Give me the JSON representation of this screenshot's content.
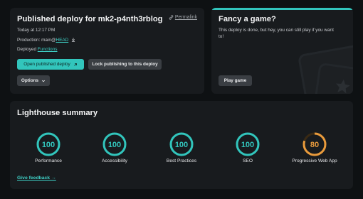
{
  "deploy": {
    "title": "Published deploy for mk2-p4nth3rblog",
    "permalink": "Permalink",
    "time": "Today at 12:17 PM",
    "production_prefix": "Production: main@",
    "production_ref": "HEAD",
    "deployed_prefix": "Deployed ",
    "deployed_link": "Functions",
    "open_button": "Open published deploy",
    "lock_button": "Lock publishing to this deploy",
    "options_button": "Options"
  },
  "game": {
    "title": "Fancy a game?",
    "text_line1": "This deploy is done, but hey, you can still play if you want",
    "text_line2": "to!",
    "play_button": "Play game"
  },
  "lighthouse": {
    "title": "Lighthouse summary",
    "feedback": "Give feedback →",
    "scores": [
      {
        "label": "Performance",
        "value": "100",
        "fraction": 1.0,
        "color": "#32c5bc"
      },
      {
        "label": "Accessibility",
        "value": "100",
        "fraction": 1.0,
        "color": "#32c5bc"
      },
      {
        "label": "Best Practices",
        "value": "100",
        "fraction": 1.0,
        "color": "#32c5bc"
      },
      {
        "label": "SEO",
        "value": "100",
        "fraction": 1.0,
        "color": "#32c5bc"
      },
      {
        "label": "Progressive Web App",
        "value": "80",
        "fraction": 0.8,
        "color": "#e99b3c"
      }
    ]
  },
  "colors": {
    "accent": "#32c5bc",
    "warning": "#e99b3c",
    "card": "#181b1e",
    "background": "#0e1113"
  }
}
